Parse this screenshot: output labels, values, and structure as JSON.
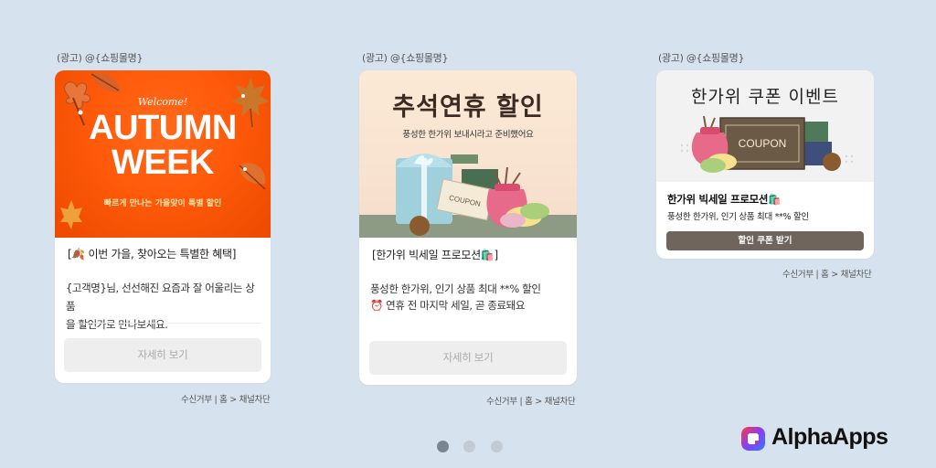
{
  "carousel": [
    {
      "ad_label": "(광고) @{쇼핑몰명}",
      "banner": {
        "welcome": "Welcome!",
        "headline_line1": "AUTUMN",
        "headline_line2": "WEEK",
        "subtitle": "빠르게 만나는 가을맞이 특별 할인"
      },
      "title": "[🍂 이번 가을, 찾아오는 특별한 혜택]",
      "body_line1": "{고객명}님, 선선해진 요즘과 잘 어울리는 상품",
      "body_line2": "을 할인가로 만나보세요.",
      "button_label": "자세히 보기",
      "footer": "수신거부 | 홈 > 채널차단"
    },
    {
      "ad_label": "(광고) @{쇼핑몰명}",
      "banner": {
        "headline": "추석연휴 할인",
        "subtitle": "풍성한 한가위 보내시라고 준비했어요",
        "coupon_text": "COUPON"
      },
      "title": "[한가위 빅세일 프로모션🛍️]",
      "body_line1": "풍성한 한가위, 인기 상품 최대 **% 할인",
      "body_line2": "⏰ 연휴 전 마지막 세일, 곧 종료돼요",
      "button_label": "자세히 보기",
      "footer": "수신거부 | 홈 > 채널차단"
    },
    {
      "ad_label": "(광고) @{쇼핑몰명}",
      "banner": {
        "headline": "한가위 쿠폰 이벤트",
        "coupon_text": "COUPON"
      },
      "title": "한가위 빅세일 프로모션🛍️",
      "body": "풍성한 한가위, 인기 상품 최대 **% 할인",
      "button_label": "할인 쿠폰 받기",
      "footer": "수신거부 | 홈 > 채널차단"
    }
  ],
  "pagination": {
    "total": 3,
    "active_index": 0
  },
  "brand": {
    "name": "AlphaApps",
    "logo_gradient": [
      "#ff3b3b",
      "#8a3cf5",
      "#2f7bff"
    ]
  },
  "colors": {
    "background": "#d6e2ee",
    "autumn_orange": "#ff5a0a",
    "brown_button": "#6f655c",
    "grey_button": "#eeeeee"
  }
}
